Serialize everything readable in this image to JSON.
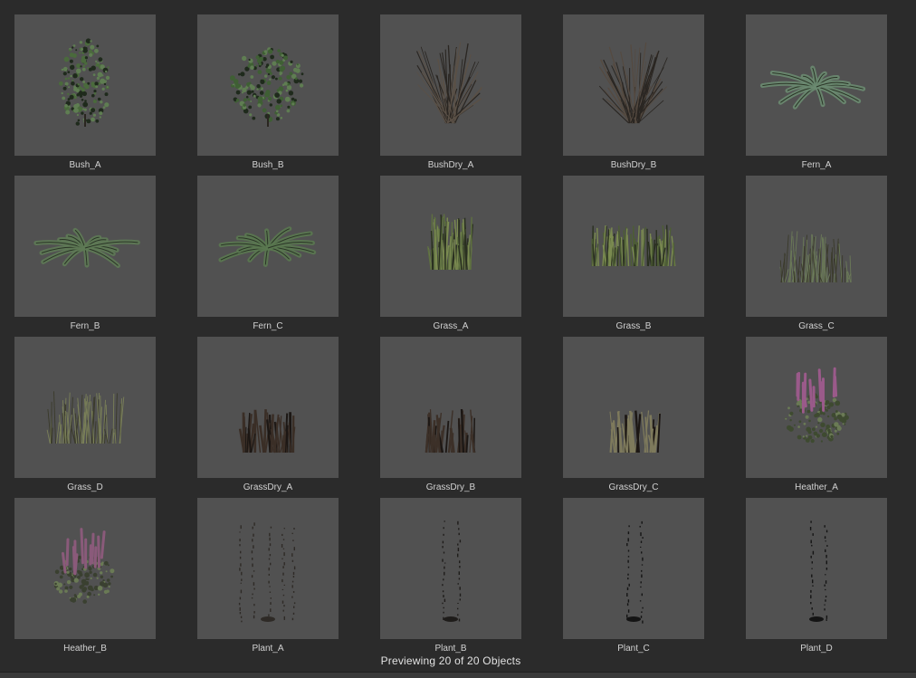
{
  "preview": {
    "status_text": "Previewing 20 of 20 Objects",
    "thumbnail_background": "#515151",
    "window_background": "#2b2b2b",
    "items": [
      {
        "label": "Bush_A",
        "kind": "bush",
        "color": "#4a6a3c"
      },
      {
        "label": "Bush_B",
        "kind": "bush-round",
        "color": "#3f5f34"
      },
      {
        "label": "BushDry_A",
        "kind": "dry-bush",
        "color": "#5a5046"
      },
      {
        "label": "BushDry_B",
        "kind": "dry-bush",
        "color": "#554a40"
      },
      {
        "label": "Fern_A",
        "kind": "fern",
        "color": "#6a8a70"
      },
      {
        "label": "Fern_B",
        "kind": "fern",
        "color": "#5e7a55"
      },
      {
        "label": "Fern_C",
        "kind": "fern",
        "color": "#5a7850"
      },
      {
        "label": "Grass_A",
        "kind": "grass",
        "color": "#5e7040"
      },
      {
        "label": "Grass_B",
        "kind": "grass-wide",
        "color": "#4d5e34"
      },
      {
        "label": "Grass_C",
        "kind": "grass-sparse",
        "color": "#6b7a58"
      },
      {
        "label": "Grass_D",
        "kind": "grass-sparse",
        "color": "#7a8058"
      },
      {
        "label": "GrassDry_A",
        "kind": "grass-dry",
        "color": "#3a2e26"
      },
      {
        "label": "GrassDry_B",
        "kind": "grass-dry",
        "color": "#3c3028"
      },
      {
        "label": "GrassDry_C",
        "kind": "grass-dry-light",
        "color": "#7e7a5c"
      },
      {
        "label": "Heather_A",
        "kind": "heather",
        "color": "#3e4a30",
        "accent": "#9a5a8a"
      },
      {
        "label": "Heather_B",
        "kind": "heather",
        "color": "#3a4030",
        "accent": "#8a5a7a"
      },
      {
        "label": "Plant_A",
        "kind": "plant-tall",
        "color": "#2e2a26"
      },
      {
        "label": "Plant_B",
        "kind": "plant-thin",
        "color": "#1e1c1a"
      },
      {
        "label": "Plant_C",
        "kind": "plant-thin",
        "color": "#141414"
      },
      {
        "label": "Plant_D",
        "kind": "plant-thin",
        "color": "#141414"
      }
    ]
  }
}
